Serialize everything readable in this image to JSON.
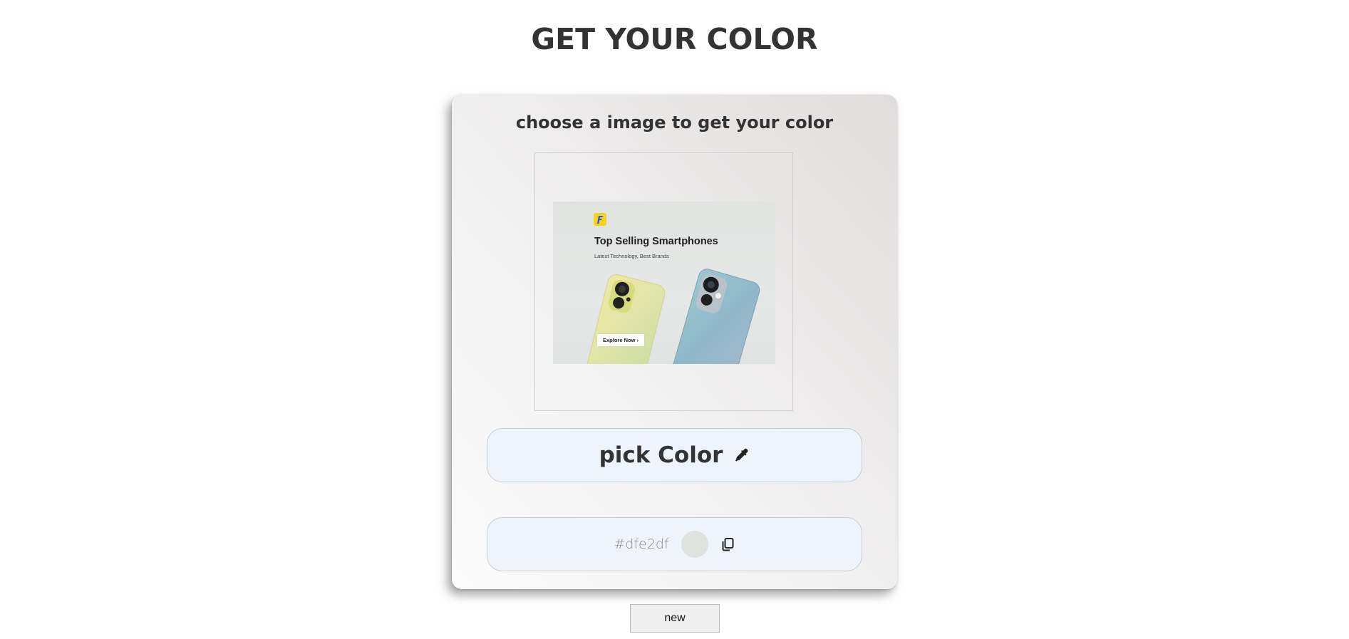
{
  "page": {
    "title": "GET YOUR COLOR"
  },
  "card": {
    "heading": "choose a image to get your color",
    "image": {
      "banner_title": "Top Selling Smartphones",
      "banner_subtitle": "Latest Technology, Best Brands",
      "banner_button": "Explore Now  ›",
      "logo_icon": "flipkart-logo"
    },
    "pick_button": {
      "label": "pick Color",
      "icon": "eyedropper-icon"
    },
    "result": {
      "hex": "#dfe2df",
      "swatch_color": "#dfe2df",
      "copy_icon": "copy-icon"
    }
  },
  "new_button": {
    "label": "new"
  },
  "colors": {
    "text": "#333333",
    "pill_background": "#edf4fb",
    "pill_border": "#c9cdd1",
    "hex_text": "#8a8a8a"
  }
}
